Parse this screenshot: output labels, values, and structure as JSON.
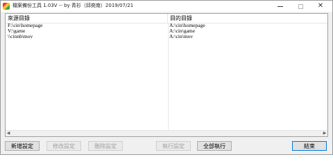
{
  "window": {
    "title": "檔案備份工具 1.03V -- by 青衫（邱奕南）2019/07/21",
    "controls": {
      "minimize": "minimize",
      "maximize": "maximize",
      "close": "✕"
    }
  },
  "table": {
    "columns": [
      "來源目錄",
      "目的目錄"
    ],
    "rows": [
      [
        "F:\\cin\\homepage",
        "A:\\cin\\homepage"
      ],
      [
        "V:\\game",
        "A:\\cin\\game"
      ],
      [
        "\\\\cinnb\\mov",
        "A:\\cin\\mov"
      ]
    ]
  },
  "scrollbar": {
    "left_arrow": "◀",
    "right_arrow": "▶"
  },
  "buttons": {
    "add": "新增設定",
    "edit": "修改設定",
    "delete": "刪除設定",
    "run": "執行設定",
    "run_all": "全部執行",
    "close": "結束"
  }
}
